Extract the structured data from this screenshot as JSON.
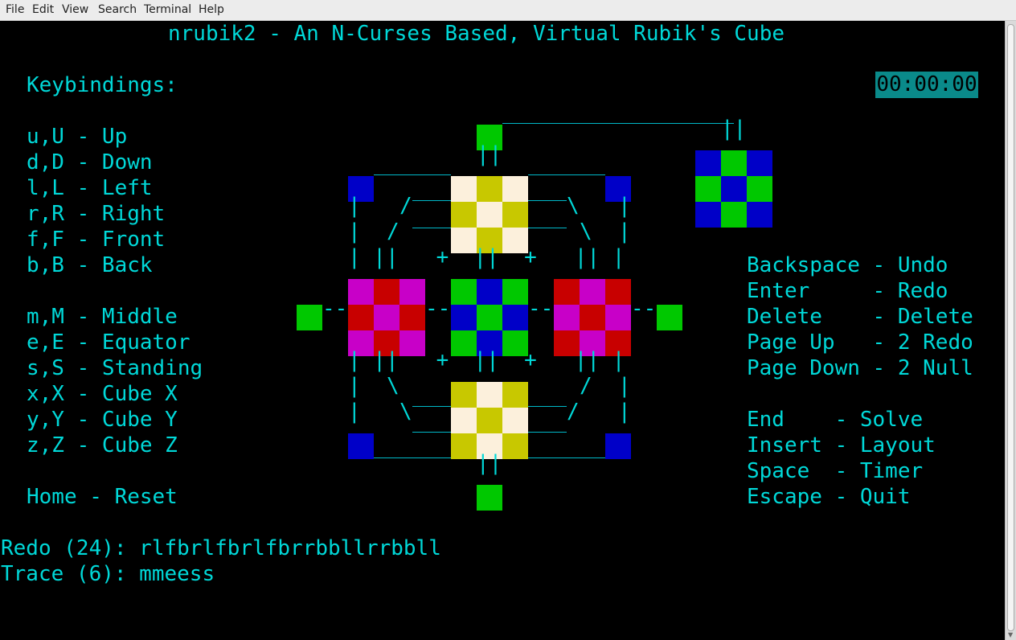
{
  "menu": [
    "File",
    "Edit",
    "View",
    "Search",
    "Terminal",
    "Help"
  ],
  "title": "nrubik2 - An N-Curses Based, Virtual Rubik's Cube",
  "keybindings": {
    "heading": "Keybindings:",
    "items": [
      "u,U - Up",
      "d,D - Down",
      "l,L - Left",
      "r,R - Right",
      "f,F - Front",
      "b,B - Back"
    ],
    "items2": [
      "m,M - Middle",
      "e,E - Equator",
      "s,S - Standing",
      "x,X - Cube X",
      "y,Y - Cube Y",
      "z,Z - Cube Z"
    ],
    "home": "Home - Reset"
  },
  "timer": "00:00:00",
  "right_bindings": {
    "group1": [
      "Backspace - Undo",
      "Enter     - Redo",
      "Delete    - Delete",
      "Page Up   - 2 Redo",
      "Page Down - 2 Null"
    ],
    "group2": [
      "End    - Solve",
      "Insert - Layout",
      "Space  - Timer",
      "Escape - Quit"
    ]
  },
  "redo": "Redo (24): rlfbrlfbrlfbrrbbllrrbbll",
  "trace": "Trace (6): mmeess",
  "colors": {
    "text": "#00d8d8",
    "green": "#00c800",
    "blue": "#0000c8",
    "red": "#c80000",
    "magenta": "#c800c8",
    "yellow": "#c8c800",
    "cream": "#fcf0dc"
  },
  "faces": {
    "top": [
      "cream",
      "yellow",
      "cream",
      "yellow",
      "cream",
      "yellow",
      "cream",
      "yellow",
      "cream"
    ],
    "bottom": [
      "yellow",
      "cream",
      "yellow",
      "cream",
      "yellow",
      "cream",
      "yellow",
      "cream",
      "yellow"
    ],
    "left": [
      "magenta",
      "red",
      "magenta",
      "red",
      "magenta",
      "red",
      "magenta",
      "red",
      "magenta"
    ],
    "center": [
      "green",
      "blue",
      "green",
      "blue",
      "green",
      "blue",
      "green",
      "blue",
      "green"
    ],
    "right": [
      "red",
      "magenta",
      "red",
      "magenta",
      "red",
      "magenta",
      "red",
      "magenta",
      "red"
    ],
    "back": [
      "blue",
      "green",
      "blue",
      "green",
      "blue",
      "green",
      "blue",
      "green",
      "blue"
    ]
  }
}
